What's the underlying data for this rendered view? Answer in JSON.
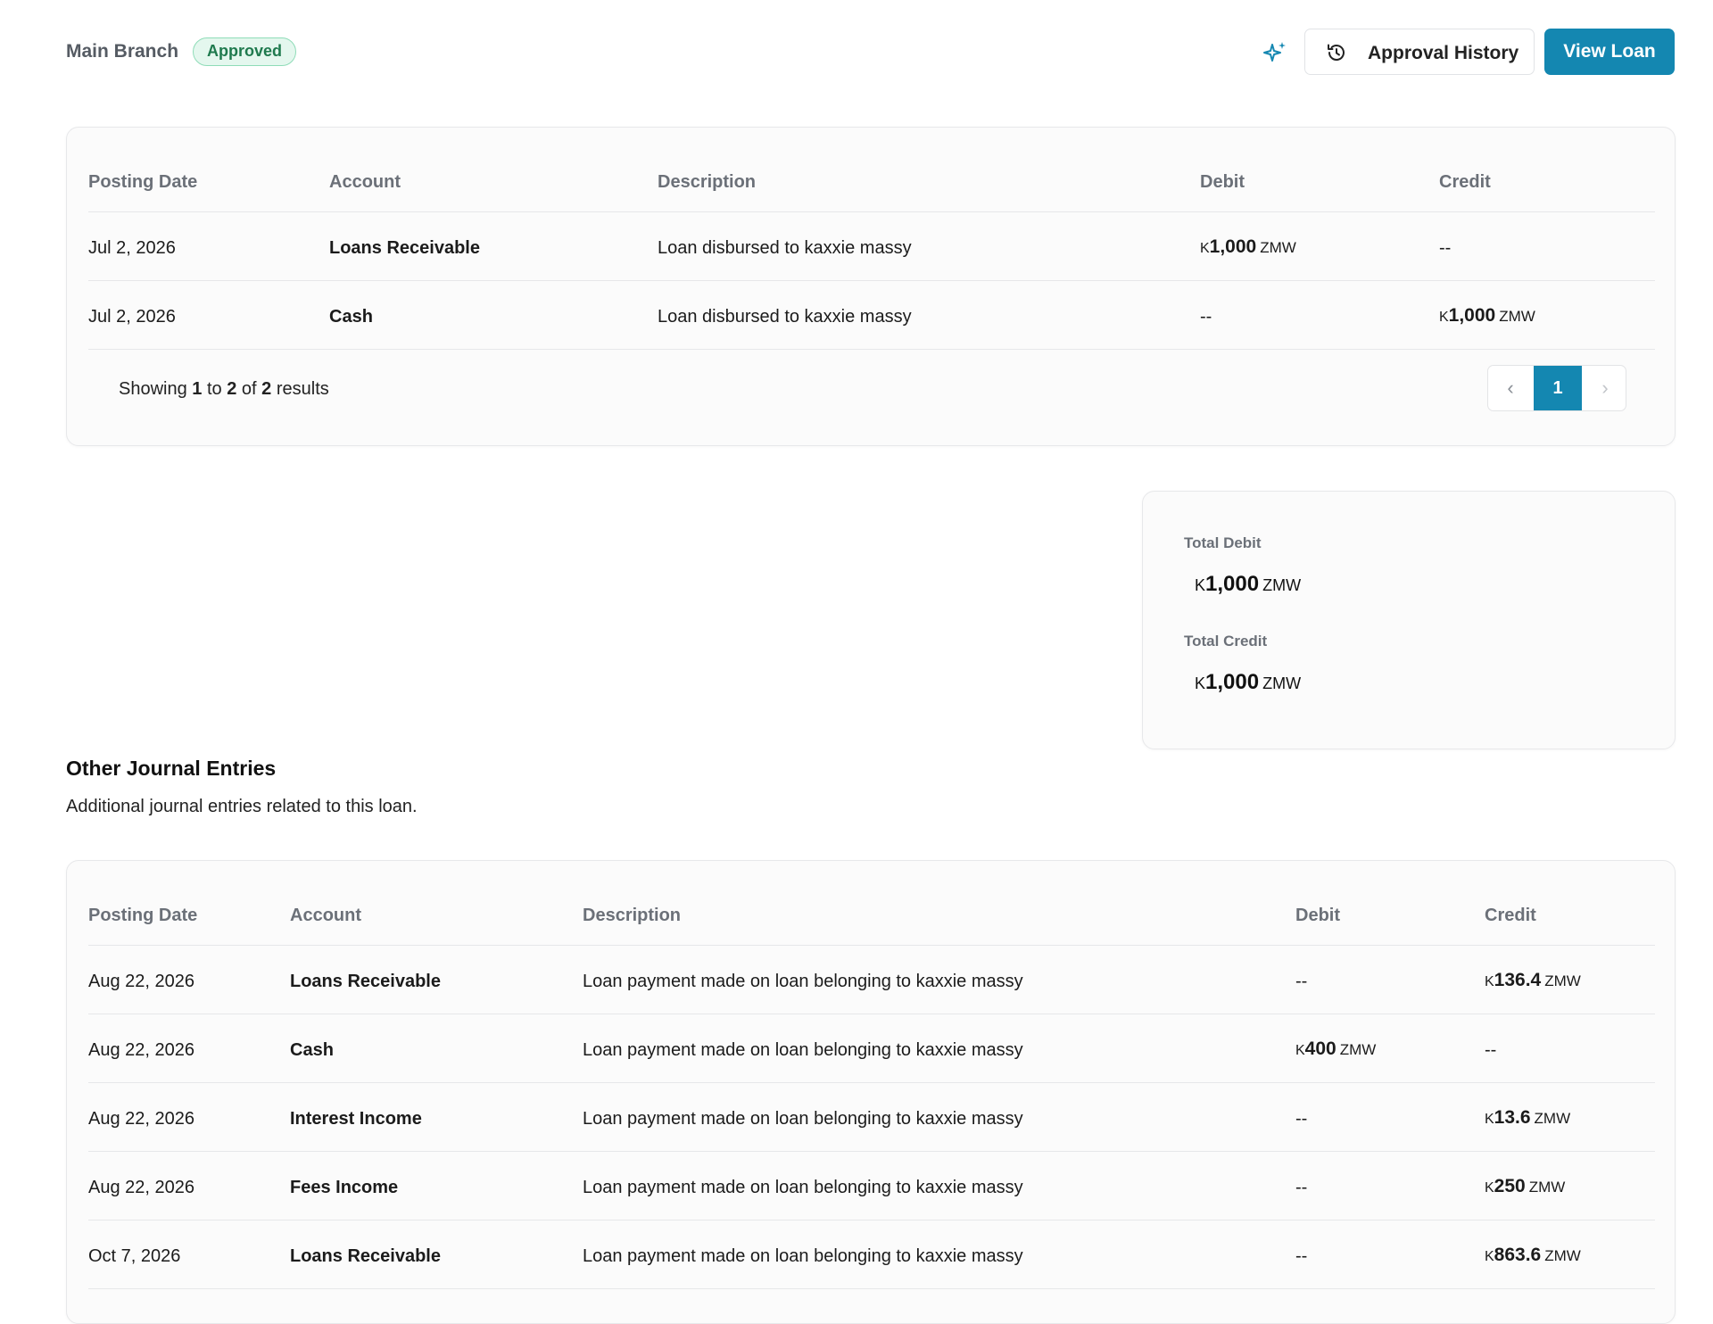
{
  "header": {
    "branch": "Main Branch",
    "status": "Approved",
    "history_label": "Approval History",
    "view_label": "View Loan"
  },
  "colors": {
    "accent": "#1487b1",
    "approved_bg": "#e4f7ee",
    "approved_text": "#1f7a4e"
  },
  "journal": {
    "columns": [
      "Posting Date",
      "Account",
      "Description",
      "Debit",
      "Credit"
    ],
    "rows": [
      {
        "date": "Jul 2, 2026",
        "account": "Loans Receivable",
        "description": "Loan disbursed to kaxxie massy",
        "debit": {
          "symbol": "K",
          "amount": "1,000",
          "currency": "ZMW"
        },
        "credit": "--"
      },
      {
        "date": "Jul 2, 2026",
        "account": "Cash",
        "description": "Loan disbursed to kaxxie massy",
        "debit": "--",
        "credit": {
          "symbol": "K",
          "amount": "1,000",
          "currency": "ZMW"
        }
      }
    ],
    "pagination": {
      "showing_prefix": "Showing",
      "from": "1",
      "to_word": "to",
      "to": "2",
      "of_word": "of",
      "total": "2",
      "suffix": "results",
      "current_page": "1",
      "prev_icon": "chevron-left-icon",
      "next_icon": "chevron-right-icon"
    }
  },
  "totals": {
    "debit_label": "Total Debit",
    "debit": {
      "symbol": "K",
      "amount": "1,000",
      "currency": "ZMW"
    },
    "credit_label": "Total Credit",
    "credit": {
      "symbol": "K",
      "amount": "1,000",
      "currency": "ZMW"
    }
  },
  "other": {
    "title": "Other Journal Entries",
    "subtitle": "Additional journal entries related to this loan.",
    "columns": [
      "Posting Date",
      "Account",
      "Description",
      "Debit",
      "Credit"
    ],
    "rows": [
      {
        "date": "Aug 22, 2026",
        "account": "Loans Receivable",
        "description": "Loan payment made on loan belonging to kaxxie massy",
        "debit": "--",
        "credit": {
          "symbol": "K",
          "amount": "136.4",
          "currency": "ZMW"
        }
      },
      {
        "date": "Aug 22, 2026",
        "account": "Cash",
        "description": "Loan payment made on loan belonging to kaxxie massy",
        "debit": {
          "symbol": "K",
          "amount": "400",
          "currency": "ZMW"
        },
        "credit": "--"
      },
      {
        "date": "Aug 22, 2026",
        "account": "Interest Income",
        "description": "Loan payment made on loan belonging to kaxxie massy",
        "debit": "--",
        "credit": {
          "symbol": "K",
          "amount": "13.6",
          "currency": "ZMW"
        }
      },
      {
        "date": "Aug 22, 2026",
        "account": "Fees Income",
        "description": "Loan payment made on loan belonging to kaxxie massy",
        "debit": "--",
        "credit": {
          "symbol": "K",
          "amount": "250",
          "currency": "ZMW"
        }
      },
      {
        "date": "Oct 7, 2026",
        "account": "Loans Receivable",
        "description": "Loan payment made on loan belonging to kaxxie massy",
        "debit": "--",
        "credit": {
          "symbol": "K",
          "amount": "863.6",
          "currency": "ZMW"
        }
      }
    ]
  }
}
